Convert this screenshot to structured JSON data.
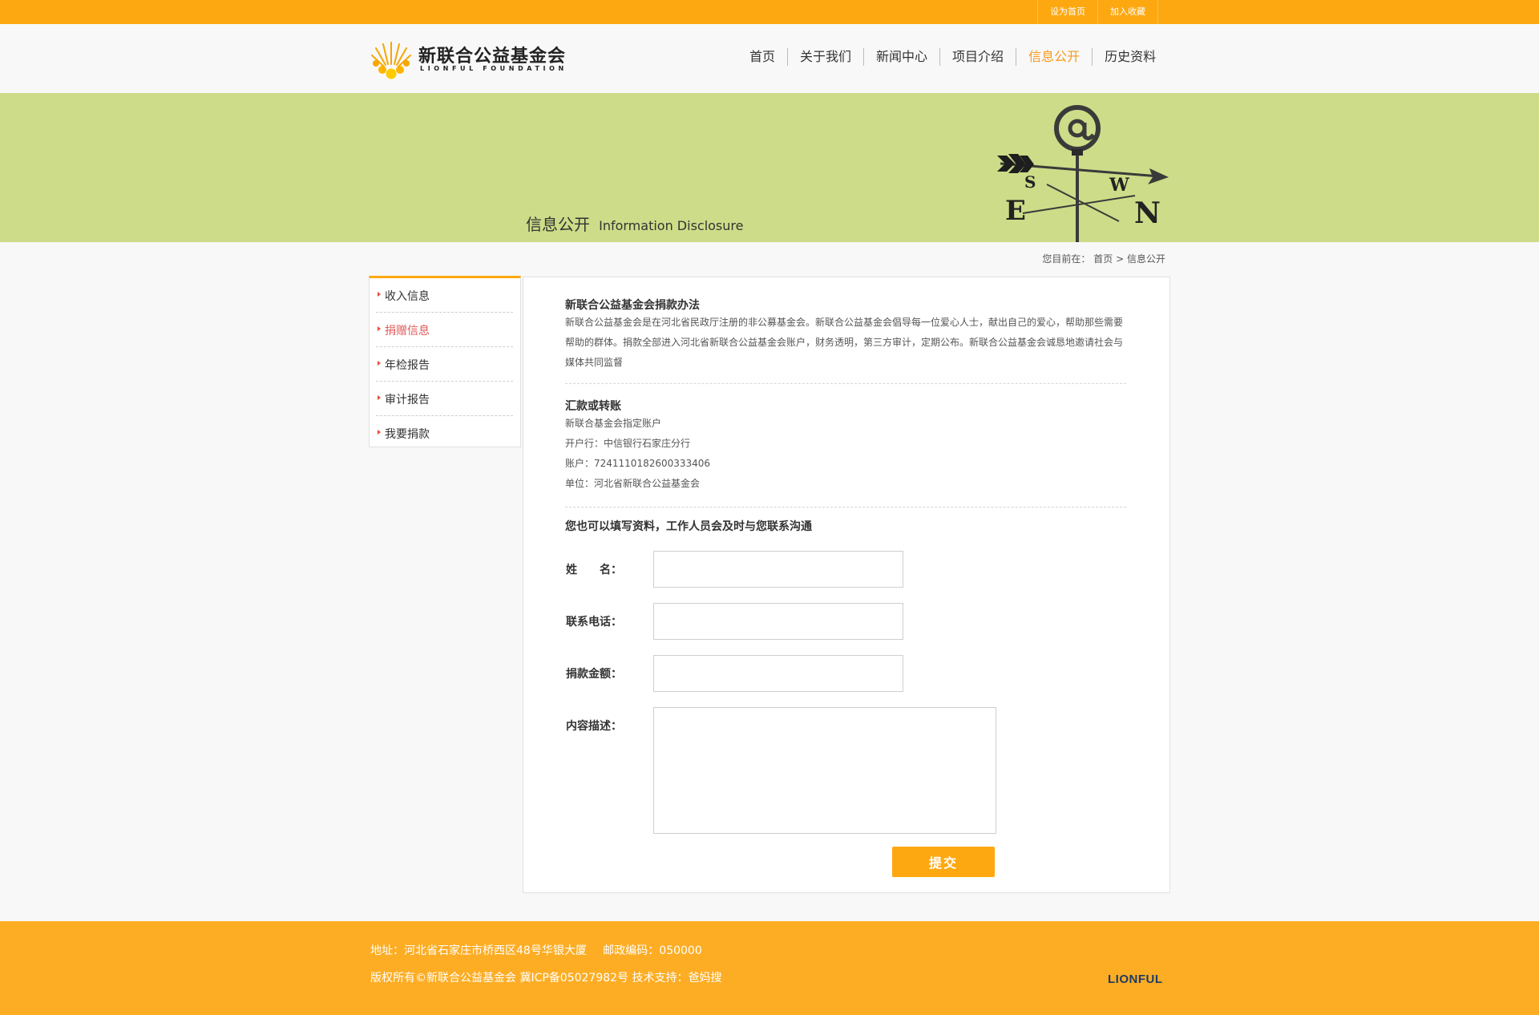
{
  "topbar": {
    "links": [
      "设为首页",
      "加入收藏"
    ]
  },
  "header": {
    "logo_cn": "新联合公益基金会",
    "logo_en": "LIONFUL FOUNDATION",
    "nav": [
      "首页",
      "关于我们",
      "新闻中心",
      "项目介绍",
      "信息公开",
      "历史资料"
    ],
    "active_nav": "信息公开"
  },
  "banner": {
    "title_cn": "信息公开",
    "title_en": "Information Disclosure"
  },
  "breadcrumb": {
    "prefix": "您目前在：",
    "home": "首页",
    "separator": ">",
    "current": "信息公开"
  },
  "sidebar": {
    "items": [
      "收入信息",
      "捐赠信息",
      "年检报告",
      "审计报告",
      "我要捐款"
    ],
    "active": "捐赠信息"
  },
  "content": {
    "method": {
      "title": "新联合公益基金会捐款办法",
      "text": "新联合公益基金会是在河北省民政厅注册的非公募基金会。新联合公益基金会倡导每一位爱心人士，献出自己的爱心，帮助那些需要帮助的群体。捐款全部进入河北省新联合公益基金会账户，财务透明，第三方审计，定期公布。新联合公益基金会诚恳地邀请社会与媒体共同监督"
    },
    "transfer": {
      "title": "汇款或转账",
      "lines": [
        "新联合基金会指定账户",
        "开户行：中信银行石家庄分行",
        "账户：7241110182600333406",
        "单位：河北省新联合公益基金会"
      ]
    },
    "form": {
      "intro": "您也可以填写资料，工作人员会及时与您联系沟通",
      "name_label": "姓　　名：",
      "phone_label": "联系电话：",
      "amount_label": "捐款金额：",
      "desc_label": "内容描述：",
      "name_value": "",
      "phone_value": "",
      "amount_value": "",
      "desc_value": "",
      "submit_label": "提交"
    }
  },
  "footer": {
    "address": "地址：河北省石家庄市桥西区48号华银大厦",
    "postcode": "邮政编码：050000",
    "copyright": "版权所有©新联合公益基金会 冀ICP备05027982号 技术支持：爸妈搜",
    "logo_text": "LIONFUL"
  },
  "colors": {
    "accent": "#fea811",
    "banner_bg": "#cddc88",
    "active_nav": "#f69a1c",
    "active_side": "#e05a5a",
    "footer_logo": "#1f3a64"
  },
  "icons": [
    "sun-logo-icon",
    "weathervane-icon",
    "sidebar-arrow-icon"
  ]
}
